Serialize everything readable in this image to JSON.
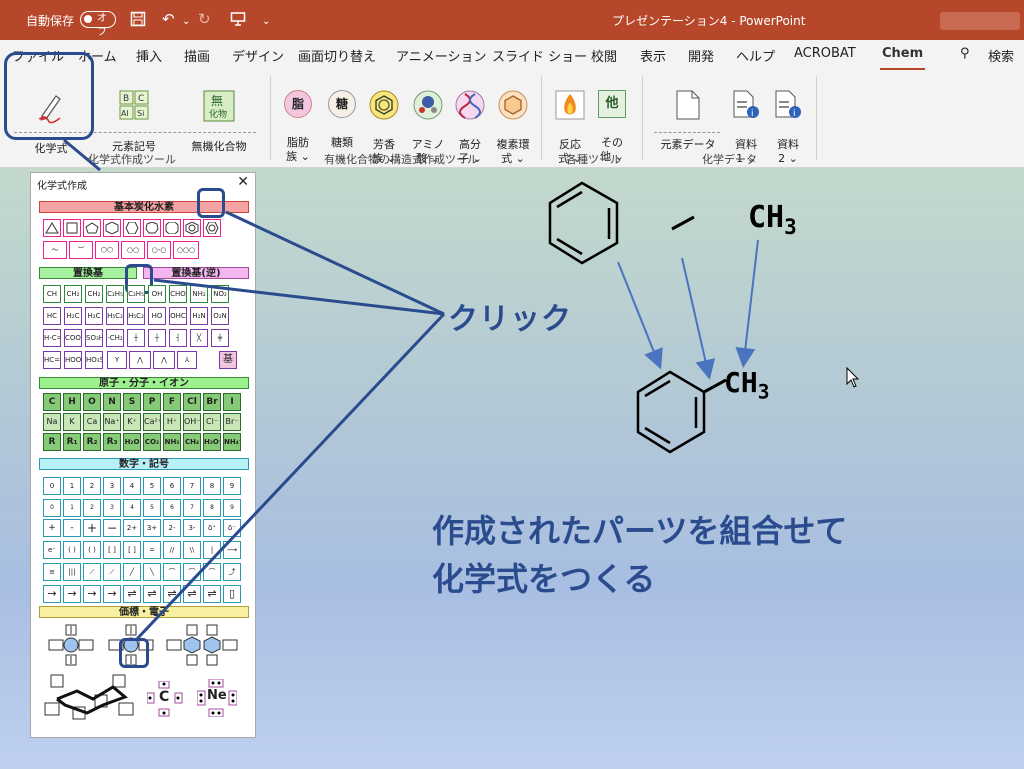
{
  "titlebar": {
    "autosave_label": "自動保存",
    "autosave_state": "オフ",
    "title": "プレゼンテーション4 - PowerPoint"
  },
  "tabs": [
    "ファイル",
    "ホーム",
    "挿入",
    "描画",
    "デザイン",
    "画面切り替え",
    "アニメーション",
    "スライド ショー",
    "校閲",
    "表示",
    "開発",
    "ヘルプ",
    "ACROBAT",
    "Chem"
  ],
  "search_label": "検索",
  "ribbon": {
    "kagakushiki": "化学式",
    "genso_kigo": "元素記号",
    "muki": "無機化合物",
    "shibo": "脂肪\n族 ⌄",
    "tou": "糖類\n⌄",
    "houkou": "芳香\n族 ⌄",
    "amino": "アミノ\n酸 ⌄",
    "kobunshi": "高分\n子 ⌄",
    "fukuso": "複素環\n式 ⌄",
    "hanno": "反応\n式 ⌄",
    "sonota": "その\n他 ⌄",
    "genso_data": "元素データ",
    "shiryo1": "資料\n1 ⌄",
    "shiryo2": "資料\n2 ⌄",
    "groups": {
      "g1": "化学式作成ツール",
      "g2": "有機化合物の構造式作成ツール",
      "g3": "各種ツール",
      "g4": "化学データ"
    },
    "icon_text": {
      "shibo": "脂",
      "tou": "糖",
      "sonota": "他",
      "muki": "無"
    }
  },
  "panel": {
    "title": "化学式作成",
    "close": "✕",
    "sections": {
      "s1": "基本炭化水素",
      "s2a": "置換基",
      "s2b": "置換基(逆)",
      "s3": "原子・分子・イオン",
      "s4": "数字・記号",
      "s5": "価標・電子"
    },
    "subst_row1": [
      "CH",
      "CH₂",
      "CH₂",
      "C₂H₅",
      "C₂H₅",
      "OH",
      "CHO",
      "NH₂",
      "NO₂"
    ],
    "subst_row2": [
      "HC",
      "H₂C",
      "H₂C",
      "H₅C₂",
      "H₅C₂",
      "HO",
      "OHC",
      "H₂N",
      "O₂N"
    ],
    "subst_row3": [
      "H-C=O",
      "COOH",
      "SO₃H",
      "-CH₂",
      "",
      "",
      "",
      "",
      ""
    ],
    "subst_row4": [
      "HC=O",
      "HOOC",
      "HO₃S",
      "",
      "",
      "",
      "",
      "基"
    ],
    "atom_row1": [
      "C",
      "H",
      "O",
      "N",
      "S",
      "P",
      "F",
      "Cl",
      "Br",
      "I"
    ],
    "atom_row2": [
      "Na",
      "K",
      "Ca",
      "Na⁺",
      "K⁺",
      "Ca²⁺",
      "H⁺",
      "OH⁻",
      "Cl⁻",
      "Br⁻"
    ],
    "atom_row3": [
      "R",
      "R₁",
      "R₂",
      "R₃",
      "H₂O",
      "CO₂",
      "NH₃",
      "CH₄",
      "H₃O⁺",
      "NH₄⁺"
    ],
    "num_row1": [
      "0",
      "1",
      "2",
      "3",
      "4",
      "5",
      "6",
      "7",
      "8",
      "9"
    ],
    "num_row2": [
      "0",
      "1",
      "2",
      "3",
      "4",
      "5",
      "6",
      "7",
      "8",
      "9"
    ],
    "num_row3": [
      "+",
      "-",
      "+",
      "−",
      "2+",
      "3+",
      "2-",
      "3-",
      "δ⁺",
      "δ⁻"
    ],
    "num_row4": [
      "e⁻",
      "( )",
      "( )",
      "[ ]",
      "[ ]",
      "=",
      "//",
      "\\\\",
      "|",
      "⟶"
    ],
    "num_row5": [
      "≡",
      "|||",
      "⟋",
      "⟋",
      "╱",
      "╲",
      "⌒",
      "⌒",
      "⌒",
      "⤴"
    ],
    "num_row6": [
      "→",
      "→",
      "→",
      "→",
      "⇌",
      "⇌",
      "⇌",
      "⇌",
      "⇌",
      "▯"
    ],
    "electron_c": "C",
    "electron_ne": "Ne"
  },
  "slide": {
    "click": "クリック",
    "msg_line1": "作成されたパーツを組合せて",
    "msg_line2": "化学式をつくる",
    "ch3_a": "CH",
    "ch3_b": "CH",
    "ch3_sub": "3"
  },
  "colors": {
    "accent": "#b7472a",
    "annotation": "#2a4b8d",
    "arrow": "#4a74c0"
  }
}
